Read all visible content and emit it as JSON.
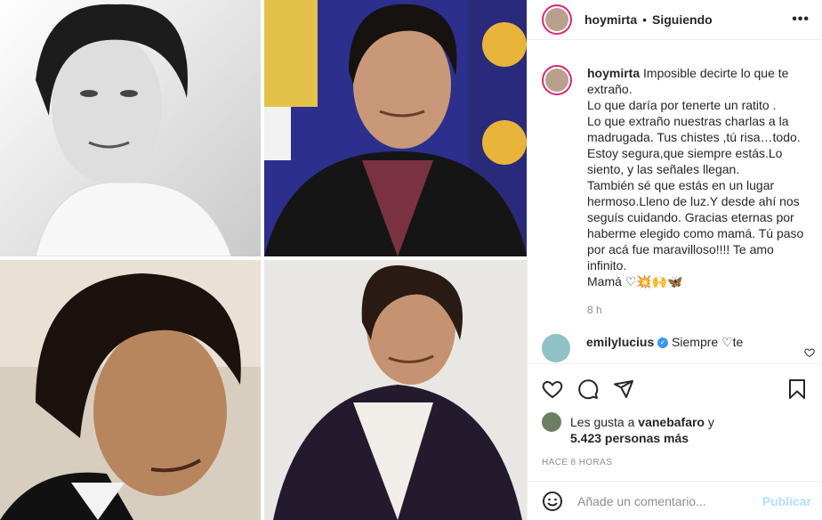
{
  "post": {
    "username": "hoymirta",
    "separator": "•",
    "follow_status": "Siguiendo",
    "more_label": "•••"
  },
  "caption": {
    "username": "hoymirta",
    "text": "Imposible decirte lo que te extraño.\nLo que daría por tenerte un ratito .\nLo que extraño nuestras charlas a la madrugada. Tus chistes ,tú risa…todo.\nEstoy segura,que siempre estás.Lo siento, y las señales llegan.\nTambién sé que estás en un lugar hermoso.Lleno de luz.Y desde ahí nos seguís cuidando. Gracias eternas por haberme elegido como mamá. Tú paso por acá fue maravilloso!!!! Te amo infinito.\nMamá ♡💥🙌🦋",
    "time": "8 h"
  },
  "comment": {
    "username": "emilylucius",
    "verified_mark": "✓",
    "text": "Siempre ♡te"
  },
  "likes": {
    "prefix": "Les gusta a ",
    "liker": "vanebafaro",
    "middle": " y",
    "count": "5.423 personas más"
  },
  "date_label": "HACE 8 HORAS",
  "add_comment": {
    "placeholder": "Añade un comentario...",
    "publish_label": "Publicar"
  },
  "icons": [
    "heart-icon",
    "comment-icon",
    "share-icon",
    "bookmark-icon",
    "emoji-icon",
    "more-options-icon"
  ],
  "colors": {
    "story_ring": "#d62976",
    "verified": "#3897f0",
    "publish_disabled": "#b2dffc",
    "secondary_text": "#8e8e8e"
  }
}
